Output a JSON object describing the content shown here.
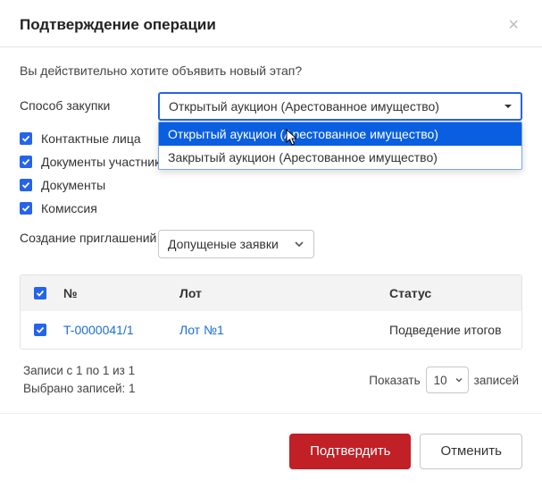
{
  "modal": {
    "title": "Подтверждение операции",
    "prompt": "Вы действительно хотите объявить новый этап?"
  },
  "method": {
    "label": "Способ закупки",
    "value": "Открытый аукцион (Арестованное имущество)",
    "options": [
      "Открытый аукцион (Арестованное имущество)",
      "Закрытый аукцион (Арестованное имущество)"
    ]
  },
  "checks": {
    "contacts": "Контактные лица",
    "docs_participant": "Документы участника",
    "docs": "Документы",
    "commission": "Комиссия"
  },
  "invite": {
    "label": "Создание приглашений",
    "value": "Допущеные заявки"
  },
  "grid": {
    "headers": {
      "num": "№",
      "lot": "Лот",
      "status": "Статус"
    },
    "row": {
      "num": "T-0000041/1",
      "lot": "Лот №1",
      "status": "Подведение итогов"
    }
  },
  "paging": {
    "records_range": "Записи с 1 по 1 из 1",
    "selected": "Выбрано записей: 1",
    "show_label": "Показать",
    "per_page": "10",
    "entries_label": "записей"
  },
  "footer": {
    "confirm": "Подтвердить",
    "cancel": "Отменить"
  }
}
